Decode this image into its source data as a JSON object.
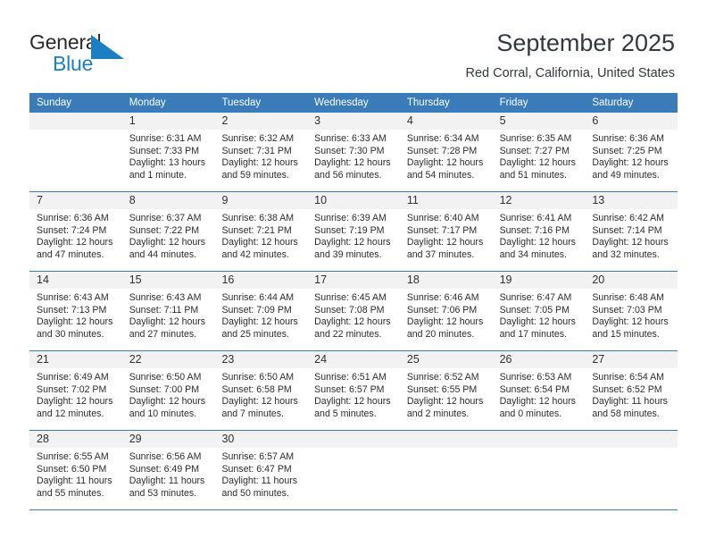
{
  "brand": {
    "word1": "General",
    "word2": "Blue",
    "accent_color": "#1c7fc4"
  },
  "header": {
    "title": "September 2025",
    "subtitle": "Red Corral, California, United States"
  },
  "calendar": {
    "header_bg": "#3a7cb9",
    "weekdays": [
      "Sunday",
      "Monday",
      "Tuesday",
      "Wednesday",
      "Thursday",
      "Friday",
      "Saturday"
    ],
    "weeks": [
      [
        {
          "day": "",
          "lines": []
        },
        {
          "day": "1",
          "lines": [
            "Sunrise: 6:31 AM",
            "Sunset: 7:33 PM",
            "Daylight: 13 hours",
            "and 1 minute."
          ]
        },
        {
          "day": "2",
          "lines": [
            "Sunrise: 6:32 AM",
            "Sunset: 7:31 PM",
            "Daylight: 12 hours",
            "and 59 minutes."
          ]
        },
        {
          "day": "3",
          "lines": [
            "Sunrise: 6:33 AM",
            "Sunset: 7:30 PM",
            "Daylight: 12 hours",
            "and 56 minutes."
          ]
        },
        {
          "day": "4",
          "lines": [
            "Sunrise: 6:34 AM",
            "Sunset: 7:28 PM",
            "Daylight: 12 hours",
            "and 54 minutes."
          ]
        },
        {
          "day": "5",
          "lines": [
            "Sunrise: 6:35 AM",
            "Sunset: 7:27 PM",
            "Daylight: 12 hours",
            "and 51 minutes."
          ]
        },
        {
          "day": "6",
          "lines": [
            "Sunrise: 6:36 AM",
            "Sunset: 7:25 PM",
            "Daylight: 12 hours",
            "and 49 minutes."
          ]
        }
      ],
      [
        {
          "day": "7",
          "lines": [
            "Sunrise: 6:36 AM",
            "Sunset: 7:24 PM",
            "Daylight: 12 hours",
            "and 47 minutes."
          ]
        },
        {
          "day": "8",
          "lines": [
            "Sunrise: 6:37 AM",
            "Sunset: 7:22 PM",
            "Daylight: 12 hours",
            "and 44 minutes."
          ]
        },
        {
          "day": "9",
          "lines": [
            "Sunrise: 6:38 AM",
            "Sunset: 7:21 PM",
            "Daylight: 12 hours",
            "and 42 minutes."
          ]
        },
        {
          "day": "10",
          "lines": [
            "Sunrise: 6:39 AM",
            "Sunset: 7:19 PM",
            "Daylight: 12 hours",
            "and 39 minutes."
          ]
        },
        {
          "day": "11",
          "lines": [
            "Sunrise: 6:40 AM",
            "Sunset: 7:17 PM",
            "Daylight: 12 hours",
            "and 37 minutes."
          ]
        },
        {
          "day": "12",
          "lines": [
            "Sunrise: 6:41 AM",
            "Sunset: 7:16 PM",
            "Daylight: 12 hours",
            "and 34 minutes."
          ]
        },
        {
          "day": "13",
          "lines": [
            "Sunrise: 6:42 AM",
            "Sunset: 7:14 PM",
            "Daylight: 12 hours",
            "and 32 minutes."
          ]
        }
      ],
      [
        {
          "day": "14",
          "lines": [
            "Sunrise: 6:43 AM",
            "Sunset: 7:13 PM",
            "Daylight: 12 hours",
            "and 30 minutes."
          ]
        },
        {
          "day": "15",
          "lines": [
            "Sunrise: 6:43 AM",
            "Sunset: 7:11 PM",
            "Daylight: 12 hours",
            "and 27 minutes."
          ]
        },
        {
          "day": "16",
          "lines": [
            "Sunrise: 6:44 AM",
            "Sunset: 7:09 PM",
            "Daylight: 12 hours",
            "and 25 minutes."
          ]
        },
        {
          "day": "17",
          "lines": [
            "Sunrise: 6:45 AM",
            "Sunset: 7:08 PM",
            "Daylight: 12 hours",
            "and 22 minutes."
          ]
        },
        {
          "day": "18",
          "lines": [
            "Sunrise: 6:46 AM",
            "Sunset: 7:06 PM",
            "Daylight: 12 hours",
            "and 20 minutes."
          ]
        },
        {
          "day": "19",
          "lines": [
            "Sunrise: 6:47 AM",
            "Sunset: 7:05 PM",
            "Daylight: 12 hours",
            "and 17 minutes."
          ]
        },
        {
          "day": "20",
          "lines": [
            "Sunrise: 6:48 AM",
            "Sunset: 7:03 PM",
            "Daylight: 12 hours",
            "and 15 minutes."
          ]
        }
      ],
      [
        {
          "day": "21",
          "lines": [
            "Sunrise: 6:49 AM",
            "Sunset: 7:02 PM",
            "Daylight: 12 hours",
            "and 12 minutes."
          ]
        },
        {
          "day": "22",
          "lines": [
            "Sunrise: 6:50 AM",
            "Sunset: 7:00 PM",
            "Daylight: 12 hours",
            "and 10 minutes."
          ]
        },
        {
          "day": "23",
          "lines": [
            "Sunrise: 6:50 AM",
            "Sunset: 6:58 PM",
            "Daylight: 12 hours",
            "and 7 minutes."
          ]
        },
        {
          "day": "24",
          "lines": [
            "Sunrise: 6:51 AM",
            "Sunset: 6:57 PM",
            "Daylight: 12 hours",
            "and 5 minutes."
          ]
        },
        {
          "day": "25",
          "lines": [
            "Sunrise: 6:52 AM",
            "Sunset: 6:55 PM",
            "Daylight: 12 hours",
            "and 2 minutes."
          ]
        },
        {
          "day": "26",
          "lines": [
            "Sunrise: 6:53 AM",
            "Sunset: 6:54 PM",
            "Daylight: 12 hours",
            "and 0 minutes."
          ]
        },
        {
          "day": "27",
          "lines": [
            "Sunrise: 6:54 AM",
            "Sunset: 6:52 PM",
            "Daylight: 11 hours",
            "and 58 minutes."
          ]
        }
      ],
      [
        {
          "day": "28",
          "lines": [
            "Sunrise: 6:55 AM",
            "Sunset: 6:50 PM",
            "Daylight: 11 hours",
            "and 55 minutes."
          ]
        },
        {
          "day": "29",
          "lines": [
            "Sunrise: 6:56 AM",
            "Sunset: 6:49 PM",
            "Daylight: 11 hours",
            "and 53 minutes."
          ]
        },
        {
          "day": "30",
          "lines": [
            "Sunrise: 6:57 AM",
            "Sunset: 6:47 PM",
            "Daylight: 11 hours",
            "and 50 minutes."
          ]
        },
        {
          "day": "",
          "lines": []
        },
        {
          "day": "",
          "lines": []
        },
        {
          "day": "",
          "lines": []
        },
        {
          "day": "",
          "lines": []
        }
      ]
    ]
  }
}
